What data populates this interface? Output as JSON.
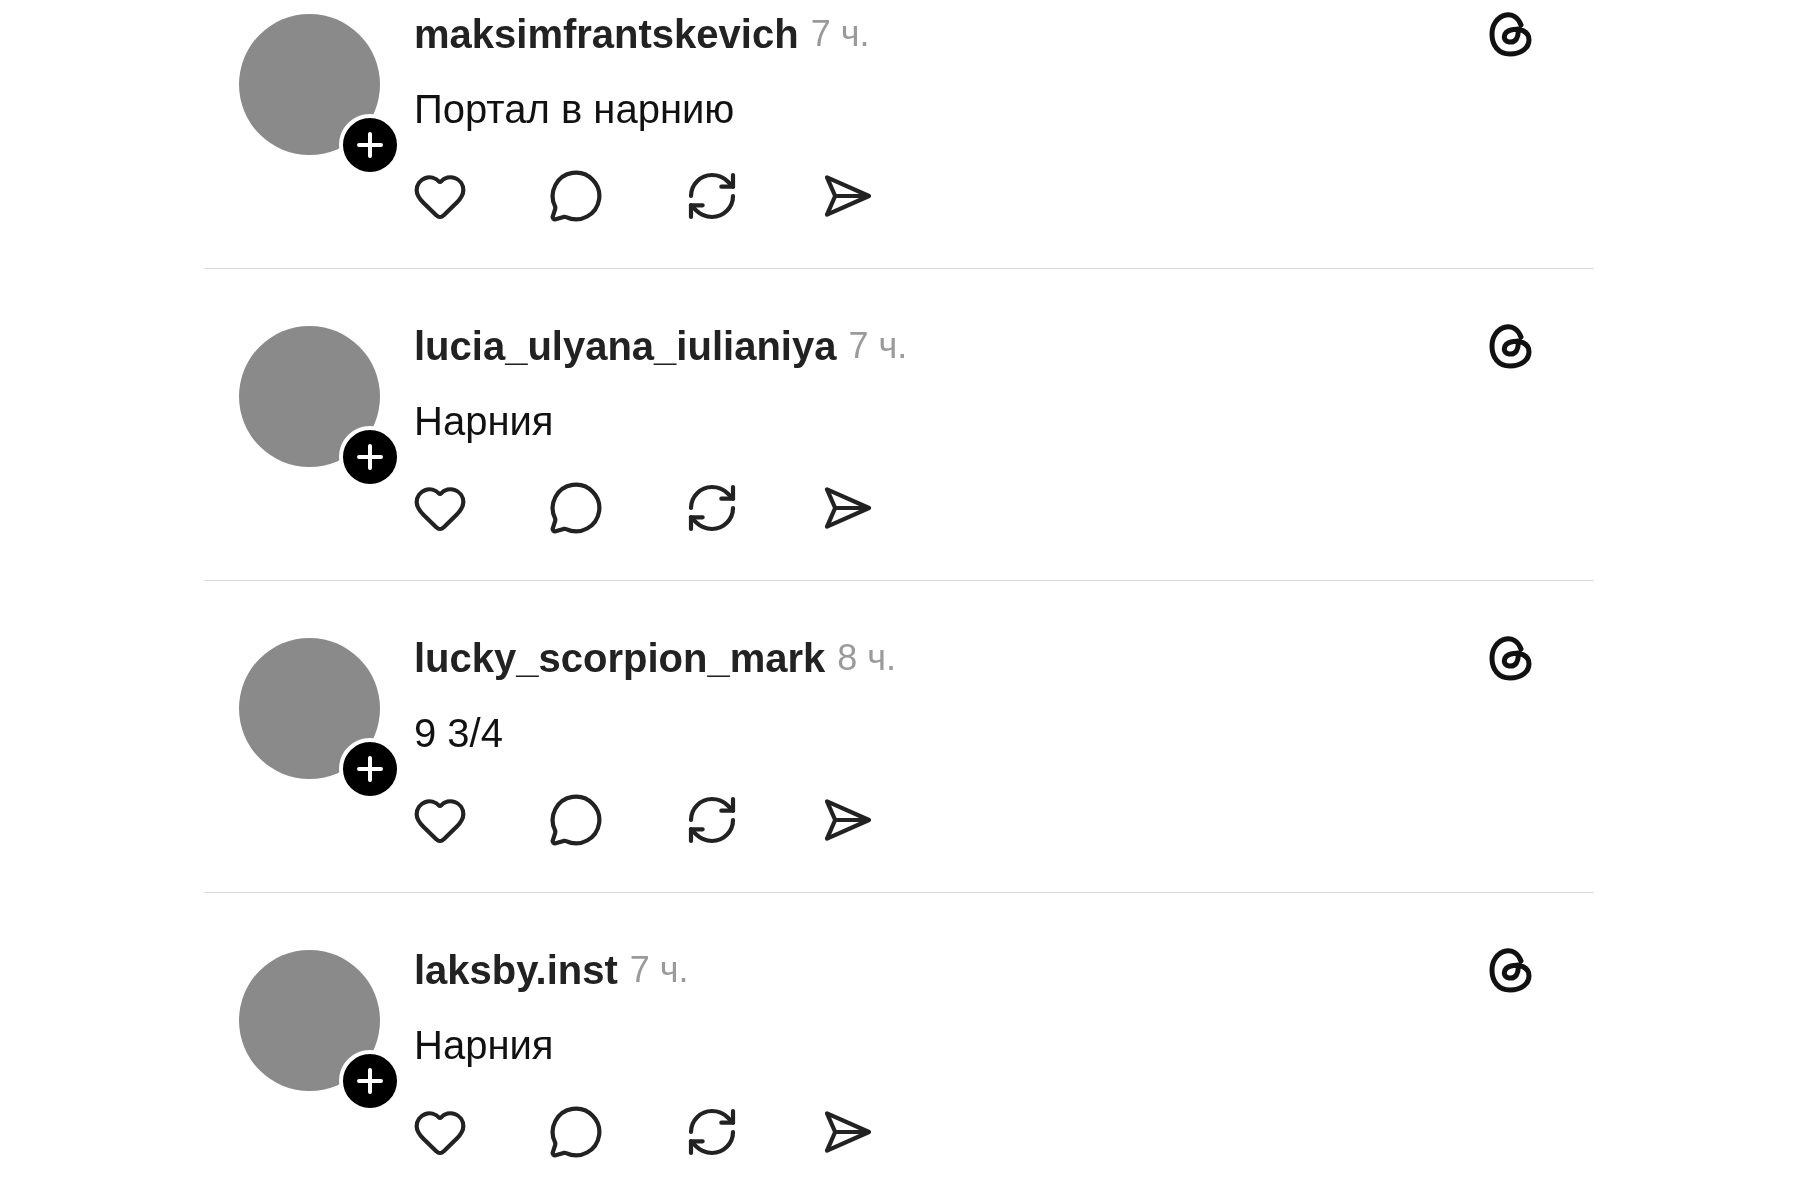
{
  "posts": [
    {
      "username": "maksimfrantskevich",
      "time": "7 ч.",
      "text": "Портал в нарнию"
    },
    {
      "username": "lucia_ulyana_iulianiya",
      "time": "7 ч.",
      "text": "Нарния"
    },
    {
      "username": "lucky_scorpion_mark",
      "time": "8 ч.",
      "text": "9 3/4"
    },
    {
      "username": "laksby.inst",
      "time": "7 ч.",
      "text": "Нарния"
    }
  ]
}
